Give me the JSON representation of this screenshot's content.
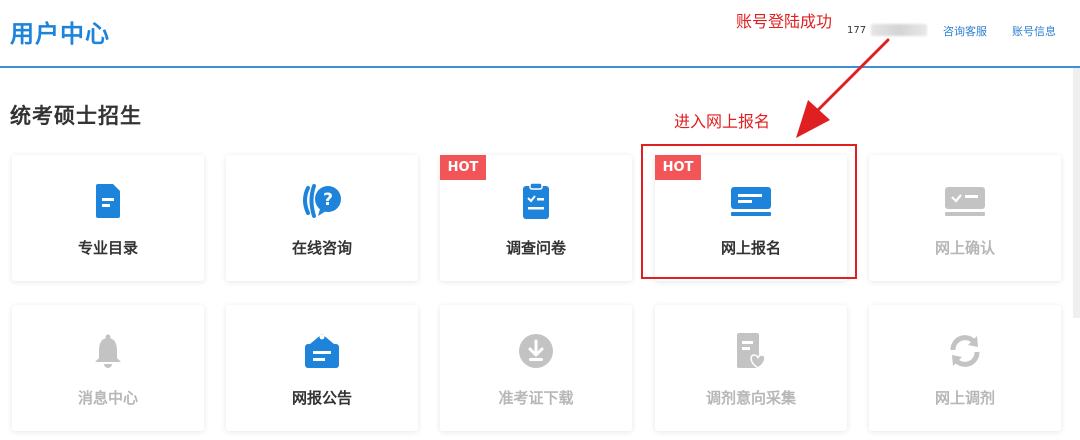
{
  "header": {
    "brand": "用户中心",
    "phone_prefix": "177",
    "links": {
      "support": "咨询客服",
      "account": "账号信息"
    }
  },
  "annotations": {
    "login_success": "账号登陆成功",
    "enter_registration": "进入网上报名"
  },
  "section": {
    "title": "统考硕士招生"
  },
  "cards": [
    {
      "label": "专业目录",
      "icon": "document-icon",
      "hot": false,
      "enabled": true
    },
    {
      "label": "在线咨询",
      "icon": "consult-chat-icon",
      "hot": false,
      "enabled": true
    },
    {
      "label": "调查问卷",
      "icon": "clipboard-check-icon",
      "hot": true,
      "enabled": true
    },
    {
      "label": "网上报名",
      "icon": "card-form-icon",
      "hot": true,
      "enabled": true
    },
    {
      "label": "网上确认",
      "icon": "confirm-card-icon",
      "hot": false,
      "enabled": false
    },
    {
      "label": "消息中心",
      "icon": "bell-icon",
      "hot": false,
      "enabled": false
    },
    {
      "label": "网报公告",
      "icon": "announcement-icon",
      "hot": false,
      "enabled": true
    },
    {
      "label": "准考证下载",
      "icon": "download-icon",
      "hot": false,
      "enabled": false
    },
    {
      "label": "调剂意向采集",
      "icon": "intent-heart-doc-icon",
      "hot": false,
      "enabled": false
    },
    {
      "label": "网上调剂",
      "icon": "refresh-icon",
      "hot": false,
      "enabled": false
    }
  ],
  "badge_text": "HOT",
  "colors": {
    "accent": "#1e83db",
    "hot": "#f25557",
    "annotation": "#e02020",
    "disabled": "#b7b7b7"
  }
}
